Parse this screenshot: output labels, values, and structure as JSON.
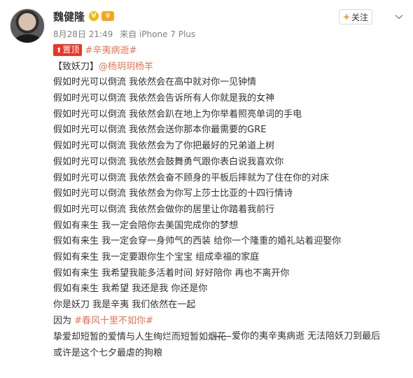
{
  "user": {
    "name": "魏健隆",
    "verified_glyph": "V",
    "member_glyph": "♛"
  },
  "meta": {
    "time": "8月28日 21:49",
    "source": "来自 iPhone 7 Plus"
  },
  "follow_button": {
    "plus": "+",
    "label": "关注"
  },
  "pin_badge": {
    "icon": "pin-icon",
    "glyph": "⬆",
    "label": "置顶"
  },
  "topic": "#辛夷病逝#",
  "dedication": {
    "prefix": "【致妖刀】",
    "mention": "@杨玥玥杨羊"
  },
  "lines": [
    "假如时光可以倒流 我依然会在高中就对你一见钟情",
    "假如时光可以倒流 我依然会告诉所有人你就是我的女神",
    "假如时光可以倒流 我依然会趴在地上为你举着照亮单词的手电",
    "假如时光可以倒流 我依然会送你那本你最需要的GRE",
    "假如时光可以倒流 我依然会为了你把最好的兄弟道上树",
    "假如时光可以倒流 我依然会鼓舞勇气跟你表白说我喜欢你",
    "假如时光可以倒流 我依然会奋不顾身的平板后摔就为了住在你的对床",
    "假如时光可以倒流 我依然会为你写上莎士比亚的十四行情诗",
    "假如时光可以倒流 我依然会做你的居里让你踏着我前行",
    "假如有来生 我一定会陪你去美国完成你的梦想",
    "假如有来生 我一定会穿一身帅气的西装 给你一个隆重的婚礼站着迎娶你",
    "假如有来生 我一定要跟你生个宝宝 组成幸福的家庭",
    "假如有来生 我希望我能多活着时间 好好陪你 再也不离开你",
    "假如有来生 我希望 我还是我 你还是你",
    "你是妖刀 我是辛夷 我们依然在一起"
  ],
  "reason": {
    "prefix": "因为 ",
    "tag": "#春风十里不如你#"
  },
  "signature": "——爱你的夷辛夷病逝 无法陪妖刀到最后",
  "closing": [
    "挚爱却短暂的爱情与人生绚烂而短暂如烟花",
    "或许是这个七夕最虐的狗粮"
  ],
  "colors": {
    "link": "#eb7350",
    "pin_badge": "#e8362a",
    "verified": "#f7b800",
    "follow_plus": "#ff8200"
  }
}
